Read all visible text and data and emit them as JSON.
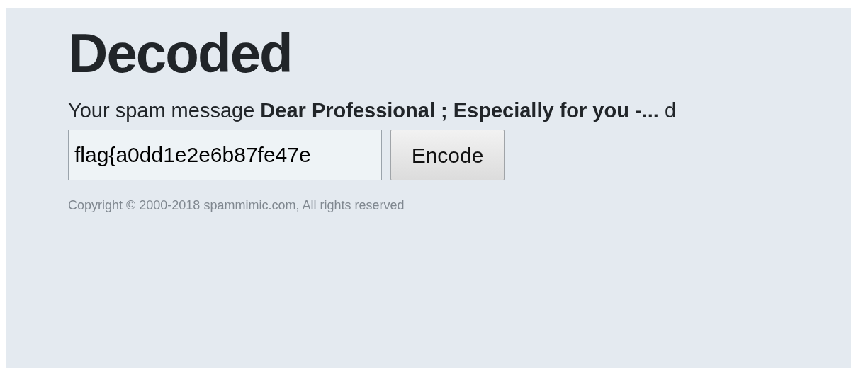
{
  "heading": "Decoded",
  "message": "Your spam message **Dear Professional ; Especially for you -...** d",
  "input": {
    "value": "flag{a0dd1e2e6b87fe47e"
  },
  "button": "Encode",
  "footer": "Copyright © 2000-2018 spammimic.com, All rights reserved"
}
